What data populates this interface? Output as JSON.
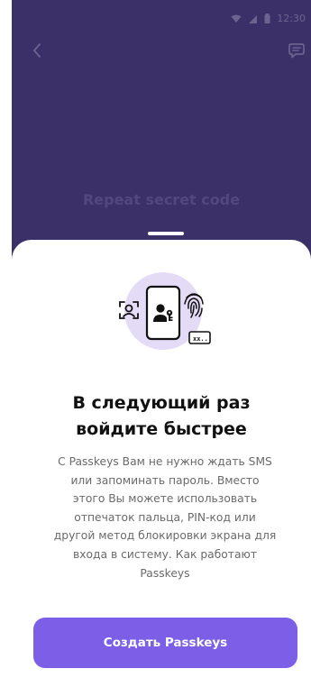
{
  "status_bar": {
    "time": "12:30",
    "wifi_icon": "wifi-icon",
    "signal_icon": "signal-icon",
    "battery_icon": "battery-icon"
  },
  "top_bar": {
    "back_icon": "chevron-left-icon",
    "chat_icon": "chat-bubble-icon"
  },
  "background_title": "Repeat secret code",
  "sheet": {
    "title_line1": "В следующий раз",
    "title_line2": "войдите быстрее",
    "body_line1": "С Passkeys Вам не нужно ждать SMS",
    "body_line2": "или запоминать пароль. Вместо",
    "body_line3": "этого Вы можете использовать",
    "body_line4": "отпечаток пальца, PIN-код или",
    "body_line5": "другой метод блокировки экрана для",
    "body_line6_prefix": "входа в систему.",
    "link_text_part1": "Как работают",
    "link_text_part2": "Passkeys",
    "illustration_badge": "xx..",
    "create_button_label": "Создать Passkeys"
  },
  "colors": {
    "backdrop": "#3b3168",
    "accent": "#7c5fe6",
    "illustration_bg": "#e4dcf7"
  }
}
